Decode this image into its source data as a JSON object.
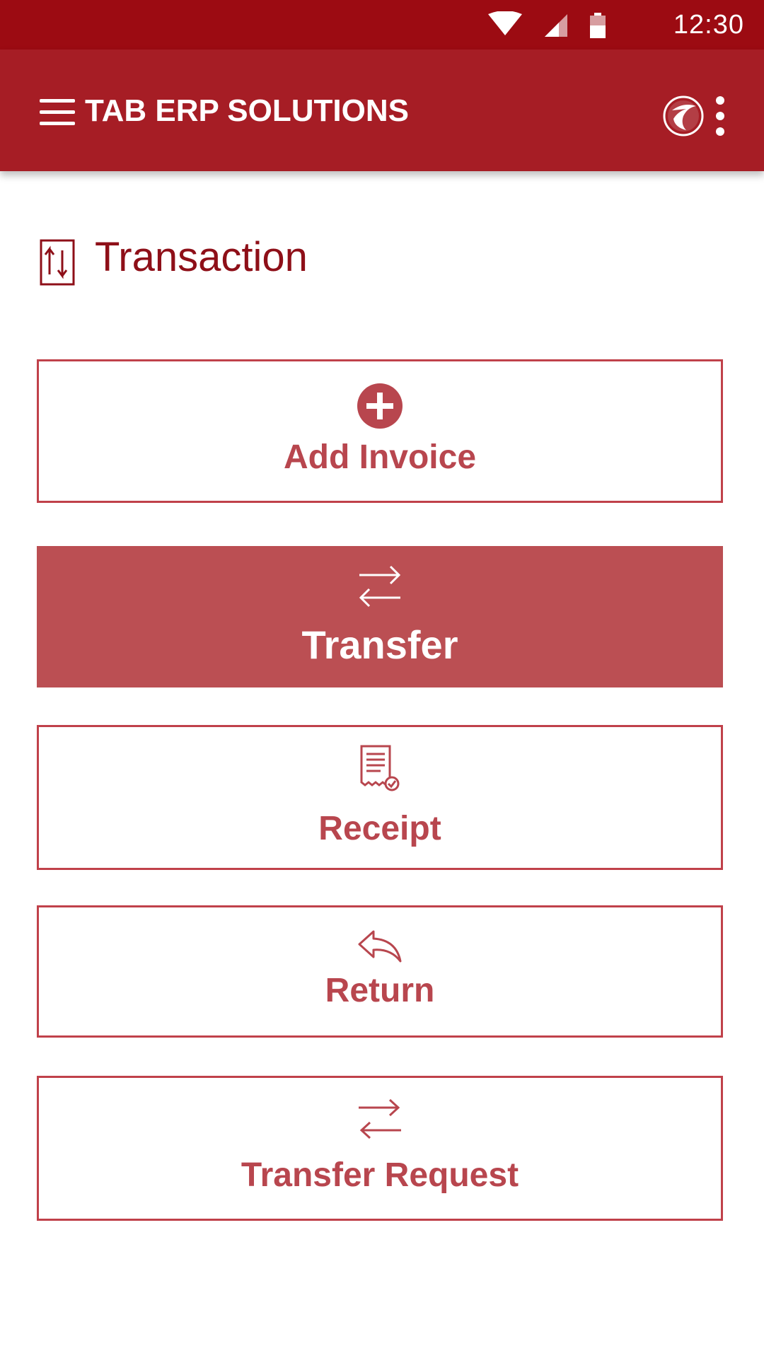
{
  "status_bar": {
    "time": "12:30"
  },
  "app_bar": {
    "title": "TAB ERP SOLUTIONS"
  },
  "section": {
    "title": "Transaction"
  },
  "actions": [
    {
      "label": "Add Invoice",
      "icon": "plus-circle-icon"
    },
    {
      "label": "Transfer",
      "icon": "swap-arrows-icon"
    },
    {
      "label": "Receipt",
      "icon": "receipt-icon"
    },
    {
      "label": "Return",
      "icon": "reply-icon"
    },
    {
      "label": "Transfer Request",
      "icon": "swap-arrows-icon"
    }
  ],
  "colors": {
    "status_bar": "#9c0b12",
    "app_bar": "#a61d25",
    "accent": "#b8464e",
    "active_bg": "#bb4f53"
  }
}
